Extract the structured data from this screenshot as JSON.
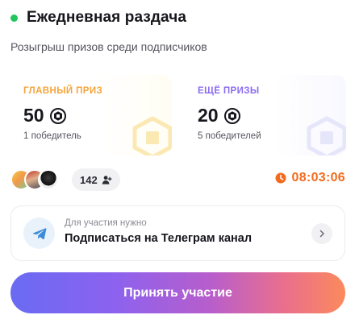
{
  "header": {
    "title": "Ежедневная раздача",
    "subtitle": "Розыгрыш призов среди подписчиков",
    "status_color": "#22c55e"
  },
  "prizes": [
    {
      "label": "ГЛАВНЫЙ ПРИЗ",
      "value": "50",
      "winners": "1 победитель",
      "label_color": "#f5a43a",
      "icon": "coin-icon"
    },
    {
      "label": "ЕЩЁ ПРИЗЫ",
      "value": "20",
      "winners": "5 победителей",
      "label_color": "#8b6cf0",
      "icon": "coin-icon"
    }
  ],
  "participants": {
    "count": "142",
    "icon": "user-plus-icon"
  },
  "timer": {
    "value": "08:03:06",
    "color": "#f36b1f",
    "icon": "clock-icon"
  },
  "task": {
    "hint": "Для участия нужно",
    "title": "Подписаться на Телеграм канал",
    "icon": "telegram-icon"
  },
  "cta": {
    "label": "Принять участие"
  }
}
